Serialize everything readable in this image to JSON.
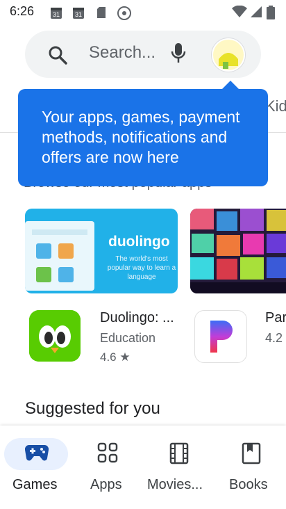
{
  "status_bar": {
    "time": "6:26",
    "calendar_1": "31",
    "calendar_2": "31"
  },
  "search": {
    "placeholder": "Search..."
  },
  "tabs_peek": "Kid",
  "subtitle_peek": "Browse our most popular apps",
  "tooltip": {
    "text": "Your apps, games, payment methods, notifications and offers are now here"
  },
  "banner": {
    "title": "duolingo",
    "subtitle": "The world's most popular way to learn a language"
  },
  "apps": [
    {
      "name": "Duolingo: ...",
      "category": "Education",
      "rating": "4.6 ★"
    },
    {
      "name": "Par",
      "rating": "4.2"
    }
  ],
  "section": {
    "title": "Suggested for you"
  },
  "nav": [
    {
      "label": "Games",
      "active": true
    },
    {
      "label": "Apps"
    },
    {
      "label": "Movies..."
    },
    {
      "label": "Books"
    }
  ],
  "colors": {
    "accent": "#1a73e8",
    "active_pill": "#e8f0fe",
    "duolingo_green": "#58cc02"
  }
}
